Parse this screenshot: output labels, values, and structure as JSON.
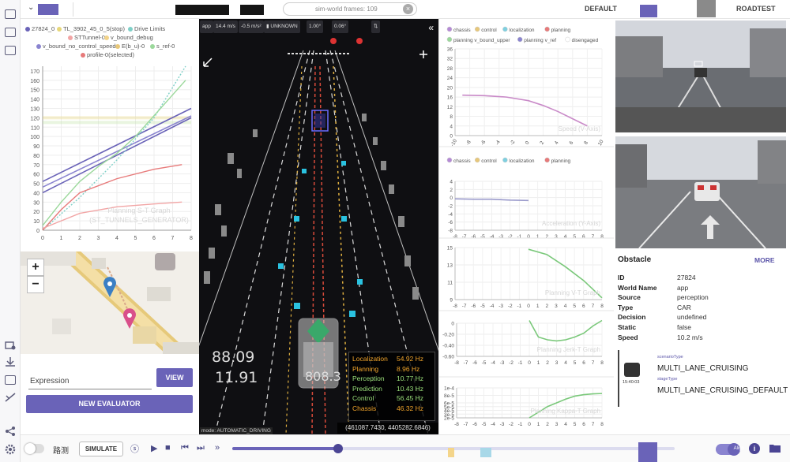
{
  "topbar": {
    "search_text": "sim-world frames: 109",
    "mode_default": "DEFAULT",
    "mode_roadtest": "ROADTEST"
  },
  "st_graph": {
    "legend": [
      {
        "label": "27824_0",
        "color": "#6a63b8"
      },
      {
        "label": "TL_3902_45_0_5(stop)",
        "color": "#e7d77a"
      },
      {
        "label": "Drive Limits",
        "color": "#7fd0c8"
      },
      {
        "label": "STTunnel-0",
        "color": "#f2a5a5"
      },
      {
        "label": "v_bound_debug",
        "color": "#f2d38a"
      },
      {
        "label": "v_bound_no_control_speed",
        "color": "#8a84d0"
      },
      {
        "label": "E(b_u)-0",
        "color": "#e7c77a"
      },
      {
        "label": "s_ref-0",
        "color": "#9bd89b"
      },
      {
        "label": "profile-0(selected)",
        "color": "#e77a7a"
      }
    ],
    "watermark_1": "Planning S-T Graph",
    "watermark_2": "(ST_TUNNELS_GENERATOR)",
    "y_ticks": [
      "0",
      "10",
      "20",
      "30",
      "40",
      "50",
      "60",
      "70",
      "80",
      "90",
      "100",
      "110",
      "120",
      "130",
      "140",
      "150",
      "160",
      "170"
    ],
    "x_ticks": [
      "0",
      "1",
      "2",
      "3",
      "4",
      "5",
      "6",
      "7",
      "8"
    ]
  },
  "chart_data": [
    {
      "type": "line",
      "title": "Planning S-T Graph",
      "subtitle": "(ST_TUNNELS_GENERATOR)",
      "xlim": [
        0,
        8
      ],
      "ylim": [
        0,
        175
      ],
      "series": [
        {
          "name": "27824_0",
          "x": [
            0,
            8
          ],
          "y": [
            52,
            130
          ]
        },
        {
          "name": "v_bound_no_control_speed",
          "x": [
            0,
            8
          ],
          "y": [
            46,
            122
          ]
        },
        {
          "name": "27824_0",
          "x": [
            0,
            8
          ],
          "y": [
            40,
            120
          ]
        },
        {
          "name": "Drive Limits",
          "x": [
            0,
            2,
            4,
            6,
            7.7
          ],
          "y": [
            0,
            35,
            75,
            120,
            175
          ]
        },
        {
          "name": "s_ref-0",
          "x": [
            0,
            1,
            2,
            3,
            4,
            5,
            7.7
          ],
          "y": [
            5,
            30,
            52,
            68,
            82,
            100,
            160
          ]
        },
        {
          "name": "profile-0(selected)",
          "x": [
            0,
            1,
            2,
            4,
            6,
            7.5
          ],
          "y": [
            0,
            22,
            40,
            55,
            65,
            70
          ]
        },
        {
          "name": "STTunnel-0",
          "x": [
            0,
            1,
            2,
            4,
            6,
            7.5
          ],
          "y": [
            2,
            10,
            18,
            25,
            28,
            30
          ]
        }
      ]
    },
    {
      "type": "line",
      "title": "Speed (V-Axis)",
      "xlim": [
        -10,
        10
      ],
      "ylim": [
        0,
        36
      ],
      "x_ticks": [
        "-10",
        "-8",
        "-6",
        "-4",
        "-2",
        "0",
        "2",
        "4",
        "6",
        "8",
        "10"
      ],
      "y_ticks": [
        "0",
        "4",
        "8",
        "12",
        "16",
        "20",
        "24",
        "28",
        "32",
        "36"
      ],
      "legend": [
        "chassis",
        "control",
        "localization",
        "planning",
        "planning v_bound_upper",
        "planning v_ref",
        "disengaged"
      ],
      "series": [
        {
          "name": "planning",
          "x": [
            -9,
            -6,
            -3,
            0,
            2,
            4,
            6,
            8
          ],
          "y": [
            16.8,
            16.6,
            16.0,
            14.5,
            12.5,
            10.0,
            7.0,
            4.0
          ]
        }
      ]
    },
    {
      "type": "line",
      "title": "Acceleration (Y-Axis)",
      "xlim": [
        -8,
        8
      ],
      "ylim": [
        -8,
        4
      ],
      "x_ticks": [
        "-8",
        "-7",
        "-6",
        "-5",
        "-4",
        "-3",
        "-2",
        "-1",
        "0",
        "1",
        "2",
        "3",
        "4",
        "5",
        "6",
        "7",
        "8"
      ],
      "y_ticks": [
        "-8",
        "-6",
        "-4",
        "-2",
        "0",
        "2",
        "4"
      ],
      "legend": [
        "chassis",
        "control",
        "localization",
        "planning",
        "disengaged"
      ],
      "series": [
        {
          "name": "planning",
          "x": [
            -8,
            -6,
            -4,
            -2,
            0
          ],
          "y": [
            -0.3,
            -0.4,
            -0.4,
            -0.6,
            -0.7
          ]
        }
      ]
    },
    {
      "type": "line",
      "title": "Planning V-T Graph",
      "xlim": [
        -8,
        8
      ],
      "ylim": [
        9,
        15
      ],
      "x_ticks": [
        "-8",
        "-7",
        "-6",
        "-5",
        "-4",
        "-3",
        "-2",
        "-1",
        "0",
        "1",
        "2",
        "3",
        "4",
        "5",
        "6",
        "7",
        "8"
      ],
      "y_ticks": [
        "9",
        "11",
        "13",
        "15"
      ],
      "series": [
        {
          "name": "planning",
          "x": [
            0,
            2,
            4,
            6,
            8
          ],
          "y": [
            14.8,
            14.2,
            12.8,
            11.2,
            9.2
          ]
        }
      ]
    },
    {
      "type": "line",
      "title": "Planning Jerk-T Graph",
      "xlim": [
        -8,
        8
      ],
      "ylim": [
        -0.6,
        0.1
      ],
      "x_ticks": [
        "-8",
        "-7",
        "-6",
        "-5",
        "-4",
        "-3",
        "-2",
        "-1",
        "0",
        "1",
        "2",
        "3",
        "4",
        "5",
        "6",
        "7",
        "8"
      ],
      "y_ticks": [
        "-0.60",
        "-0.40",
        "-0.20",
        "0"
      ],
      "series": [
        {
          "name": "planning",
          "x": [
            0,
            1,
            2,
            3,
            4,
            5,
            6,
            7,
            8
          ],
          "y": [
            0.05,
            -0.25,
            -0.3,
            -0.32,
            -0.3,
            -0.25,
            -0.18,
            -0.05,
            0.05
          ]
        }
      ]
    },
    {
      "type": "line",
      "title": "Planning Kappa-T Graph",
      "xlim": [
        -8,
        8
      ],
      "ylim": [
        -5e-05,
        0.0001
      ],
      "x_ticks": [
        "-8",
        "-7",
        "-6",
        "-5",
        "-4",
        "-3",
        "-2",
        "-1",
        "0",
        "1",
        "2",
        "3",
        "4",
        "5",
        "6",
        "7",
        "8"
      ],
      "y_ticks": [
        "2e-5",
        "3e-5",
        "4e-5",
        "5e-5",
        "6e-5",
        "8e-5",
        "1e-4"
      ],
      "series": [
        {
          "name": "planning",
          "x": [
            0,
            1,
            2,
            3,
            4,
            5,
            6,
            7,
            8
          ],
          "y": [
            2e-05,
            3.5e-05,
            5e-05,
            6e-05,
            7e-05,
            7.8e-05,
            8.2e-05,
            8.4e-05,
            8.5e-05
          ]
        }
      ]
    }
  ],
  "scene": {
    "hud_speed": "14.4 m/s",
    "hud_accel": "-0.5 m/s²",
    "hud_signal": "UNKNOWN",
    "hud_steer": "1.00°",
    "hud_angle": "0.06°",
    "big_speed": "88.09",
    "big_heading": "11.91",
    "overlay_num": "808.3",
    "freqs": [
      {
        "label": "Localization",
        "value": "54.92 Hz",
        "color": "#f0a42b"
      },
      {
        "label": "Planning",
        "value": "8.96 Hz",
        "color": "#f0a42b"
      },
      {
        "label": "Perception",
        "value": "10.77 Hz",
        "color": "#9be07a"
      },
      {
        "label": "Prediction",
        "value": "10.43 Hz",
        "color": "#9be07a"
      },
      {
        "label": "Control",
        "value": "56.45 Hz",
        "color": "#9be07a"
      },
      {
        "label": "Chassis",
        "value": "46.32 Hz",
        "color": "#f0a42b"
      }
    ],
    "coords": "(461087.7430, 4405282.6846)",
    "mode": "mode: AUTOMATIC_DRIVING"
  },
  "left": {
    "expression_placeholder": "Expression",
    "view_label": "VIEW",
    "new_evaluator_label": "NEW EVALUATOR"
  },
  "obstacle": {
    "title": "Obstacle",
    "more": "MORE",
    "rows": [
      {
        "key": "ID",
        "value": "27824"
      },
      {
        "key": "World Name",
        "value": "app"
      },
      {
        "key": "Source",
        "value": "perception"
      },
      {
        "key": "Type",
        "value": "CAR"
      },
      {
        "key": "Decision",
        "value": "undefined"
      },
      {
        "key": "Static",
        "value": "false"
      },
      {
        "key": "Speed",
        "value": "10.2 m/s"
      }
    ],
    "scenario_type_label": "scenarioType",
    "scenario_type": "MULTI_LANE_CRUISING",
    "stage_type_label": "stageType",
    "stage_type": "MULTI_LANE_CRUISING_DEFAULT",
    "timestamp": "15:40:03"
  },
  "bottom": {
    "toggle_label": "路测",
    "simulate_label": "SIMULATE",
    "toggle_right_label": "Align",
    "progress": 0.24
  }
}
